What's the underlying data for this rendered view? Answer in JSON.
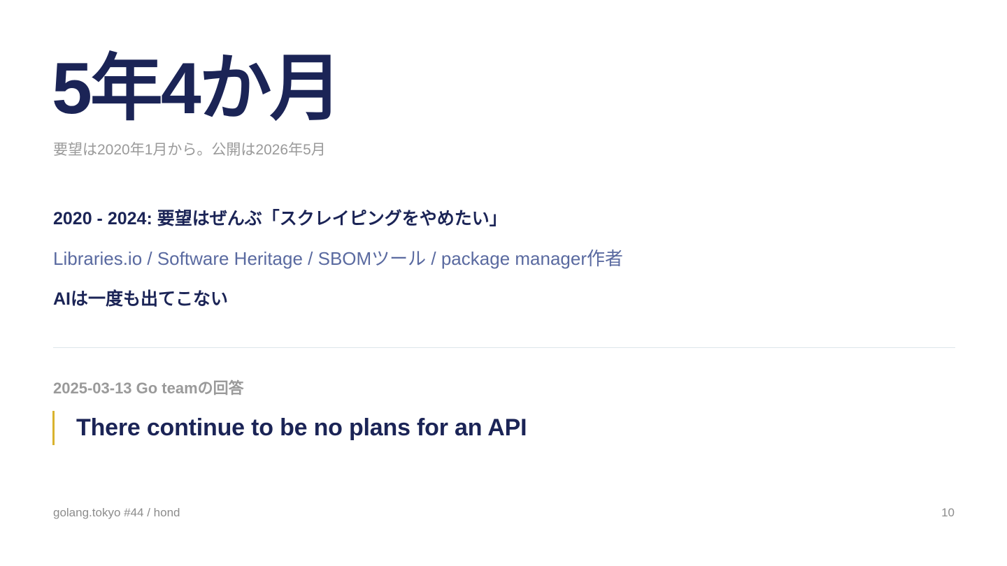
{
  "headline": "5年4か月",
  "subtitle": "要望は2020年1月から。公開は2026年5月",
  "summary": {
    "line1": "2020 - 2024: 要望はぜんぶ「スクレイピングをやめたい」",
    "line2": "Libraries.io / Software Heritage / SBOMツール / package manager作者",
    "line3": "AIは一度も出てこない"
  },
  "response": {
    "label": "2025-03-13 Go teamの回答",
    "quote": "There continue to be no plans for an API"
  },
  "footer": {
    "left": "golang.tokyo #44 / hond",
    "page_number": "10"
  },
  "colors": {
    "primary": "#1b2456",
    "muted": "#9a9a9a",
    "link": "#5a6aa0",
    "accent": "#d9b32e",
    "divider": "#dce6ea"
  }
}
